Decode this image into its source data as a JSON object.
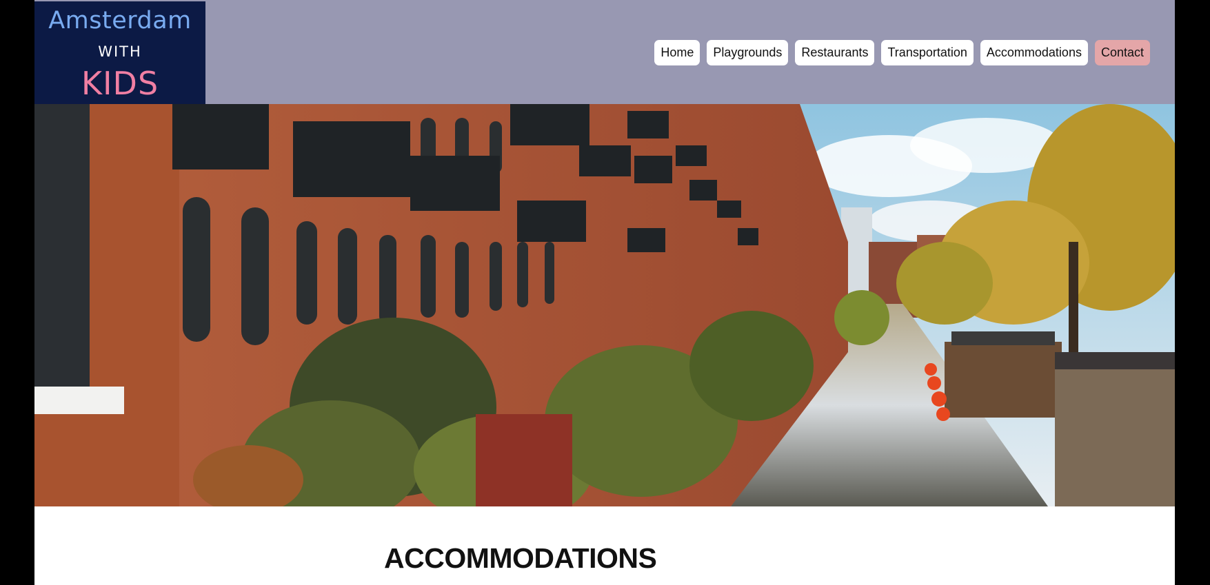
{
  "brand": {
    "line1": "Amsterdam",
    "line2": "WITH",
    "line3": "KIDS",
    "colors": {
      "bg": "#0c1a45",
      "line1": "#79abf0",
      "line2": "#ffffff",
      "line3": "#f07fa3"
    }
  },
  "header": {
    "background": "#9898b2"
  },
  "nav": {
    "items": [
      {
        "label": "Home"
      },
      {
        "label": "Playgrounds"
      },
      {
        "label": "Restaurants"
      },
      {
        "label": "Transportation"
      },
      {
        "label": "Accommodations"
      },
      {
        "label": "Contact",
        "highlight": "#e4a6a8"
      }
    ]
  },
  "hero": {
    "image": "amsterdam-canal-houses-photo"
  },
  "main": {
    "heading": "ACCOMMODATIONS"
  }
}
